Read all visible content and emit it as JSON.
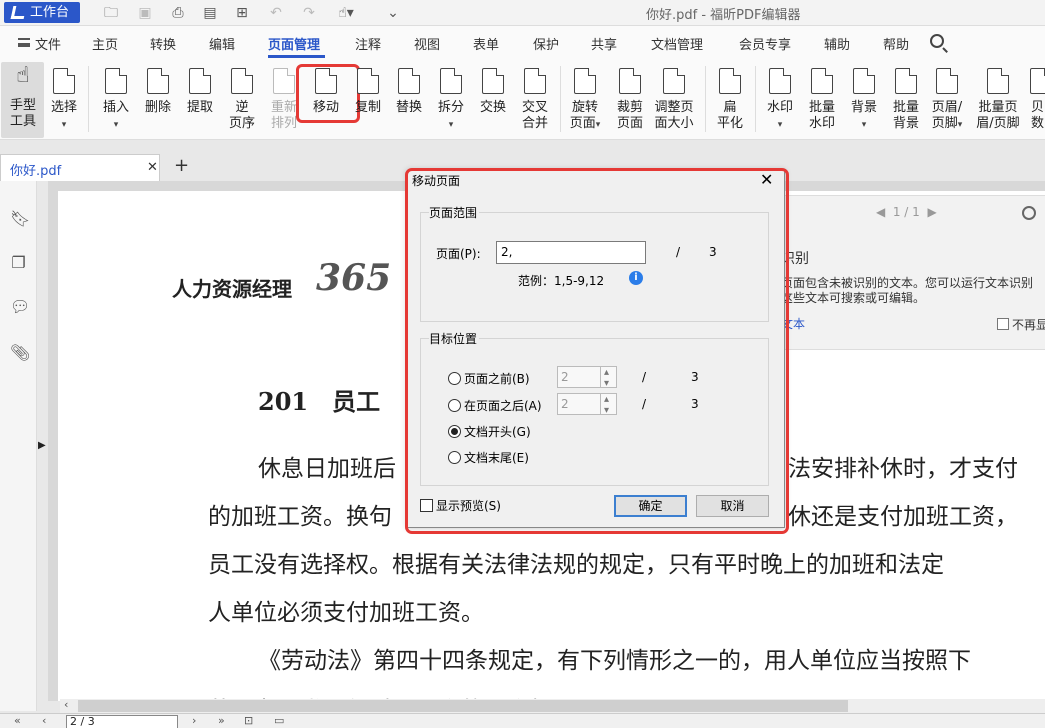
{
  "titlebar": {
    "workbench_label": "工作台",
    "window_title": "你好.pdf - 福昕PDF编辑器"
  },
  "menu": {
    "file": "文件",
    "items": [
      "主页",
      "转换",
      "编辑",
      "页面管理",
      "注释",
      "视图",
      "表单",
      "保护",
      "共享",
      "文档管理",
      "会员专享",
      "辅助",
      "帮助"
    ],
    "active": "页面管理"
  },
  "ribbon": {
    "hand_tool": [
      "手型",
      "工具"
    ],
    "select": "选择",
    "insert": "插入",
    "delete": "删除",
    "extract": "提取",
    "reverse": [
      "逆",
      "页序"
    ],
    "reorder": [
      "重新",
      "排列"
    ],
    "move": "移动",
    "copy": "复制",
    "replace": "替换",
    "split": "拆分",
    "swap": "交换",
    "interleave": [
      "交叉",
      "合并"
    ],
    "rotate": [
      "旋转",
      "页面"
    ],
    "crop": [
      "裁剪",
      "页面"
    ],
    "resize": [
      "调整页",
      "面大小"
    ],
    "flatten": [
      "扁",
      "平化"
    ],
    "watermark": "水印",
    "batch_watermark": [
      "批量",
      "水印"
    ],
    "background": "背景",
    "batch_background": [
      "批量",
      "背景"
    ],
    "header_footer": [
      "页眉/",
      "页脚"
    ],
    "batch_header_footer": [
      "批量页",
      "眉/页脚"
    ],
    "bates": [
      "贝",
      "数"
    ]
  },
  "tabs": {
    "doc_tab": "你好.pdf"
  },
  "document": {
    "brand": "人力资源经理",
    "brand_num": "365",
    "heading": "201　员工",
    "lines": [
      "休息日加班后",
      "的加班工资。换句",
      "员工没有选择权。根据有关法律法规的规定，只有平时晚上的加班和法定",
      "人单位必须支付加班工资。",
      "《劳动法》第四十四条规定，有下列情形之一的，用人单位应当按照下"
    ],
    "line1_right": "法安排补休时，才支付",
    "line2_right": "休还是支付加班工资，",
    "bottom_cut": "劳动者正常工作时间工资的工资报酬"
  },
  "notice": {
    "pager": "1 / 1",
    "title": "识别",
    "text1": "页面包含未被识别的文本。您可以运行文本识别",
    "text2": "这些文本可搜索或可编辑。",
    "link": "文本",
    "dont_show": "不再显"
  },
  "statusbar": {
    "page_value": "2 / 3"
  },
  "dialog": {
    "title": "移动页面",
    "range_group": "页面范围",
    "page_label": "页面(P):",
    "page_value": "2,",
    "slash": "/",
    "total": "3",
    "example": "范例：1,5-9,12",
    "target_group": "目标位置",
    "before_label": "页面之前(B)",
    "after_label": "在页面之后(A)",
    "start_label": "文档开头(G)",
    "end_label": "文档末尾(E)",
    "before_value": "2",
    "after_value": "2",
    "preview_label": "显示预览(S)",
    "ok": "确定",
    "cancel": "取消"
  }
}
